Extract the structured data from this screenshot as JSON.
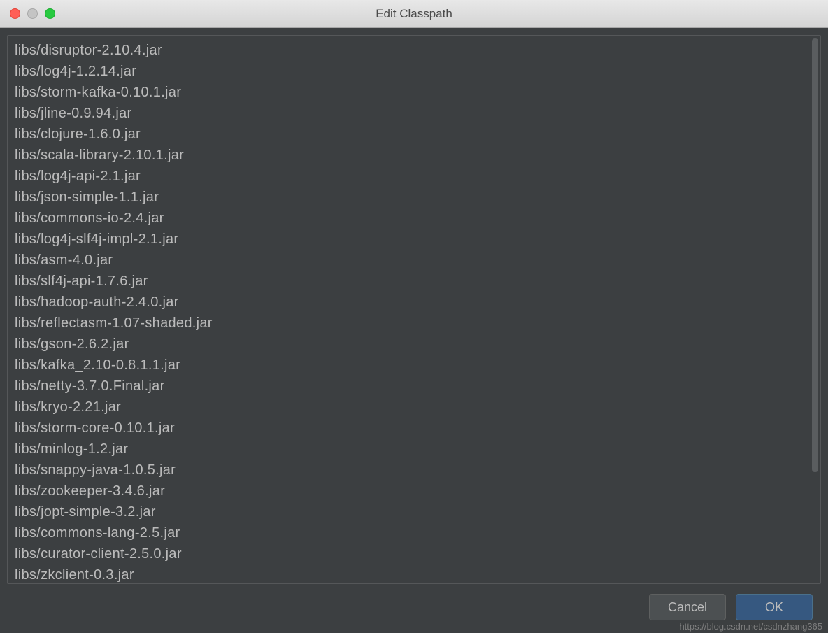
{
  "window": {
    "title": "Edit Classpath"
  },
  "list": {
    "items": [
      "libs/disruptor-2.10.4.jar",
      "libs/log4j-1.2.14.jar",
      "libs/storm-kafka-0.10.1.jar",
      "libs/jline-0.9.94.jar",
      "libs/clojure-1.6.0.jar",
      "libs/scala-library-2.10.1.jar",
      "libs/log4j-api-2.1.jar",
      "libs/json-simple-1.1.jar",
      "libs/commons-io-2.4.jar",
      "libs/log4j-slf4j-impl-2.1.jar",
      "libs/asm-4.0.jar",
      "libs/slf4j-api-1.7.6.jar",
      "libs/hadoop-auth-2.4.0.jar",
      "libs/reflectasm-1.07-shaded.jar",
      "libs/gson-2.6.2.jar",
      "libs/kafka_2.10-0.8.1.1.jar",
      "libs/netty-3.7.0.Final.jar",
      "libs/kryo-2.21.jar",
      "libs/storm-core-0.10.1.jar",
      "libs/minlog-1.2.jar",
      "libs/snappy-java-1.0.5.jar",
      "libs/zookeeper-3.4.6.jar",
      "libs/jopt-simple-3.2.jar",
      "libs/commons-lang-2.5.jar",
      "libs/curator-client-2.5.0.jar",
      "libs/zkclient-0.3.jar"
    ]
  },
  "buttons": {
    "cancel": "Cancel",
    "ok": "OK"
  },
  "watermark": "https://blog.csdn.net/csdnzhang365"
}
